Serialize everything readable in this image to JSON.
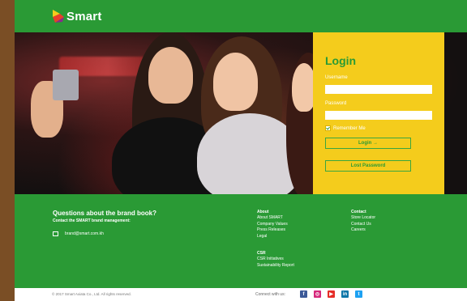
{
  "brand": {
    "name": "Smart",
    "accent": "#2a9a35",
    "panel": "#f4cc1c"
  },
  "login": {
    "title": "Login",
    "username_label": "Username",
    "password_label": "Password",
    "remember_label": "Remember Me",
    "login_button": "Login →",
    "lost_password_button": "Lost Password"
  },
  "footer": {
    "question_title": "Questions about the brand book?",
    "question_sub": "Contact the SMART brand management:",
    "email": "brand@smart.com.kh",
    "about": {
      "title": "About",
      "items": [
        "About SMART",
        "Company Values",
        "Press Releases",
        "Legal"
      ]
    },
    "csr": {
      "title": "CSR",
      "items": [
        "CSR Initiatives",
        "Sustainability Report"
      ]
    },
    "contact": {
      "title": "Contact",
      "items": [
        "Store Locator",
        "Contact Us",
        "Careers"
      ]
    }
  },
  "bottom": {
    "copyright": "© 2017 Smart Axiata Co., Ltd. All rights reserved.",
    "connect_label": "Connect with us:",
    "social": [
      {
        "icon": "facebook-icon",
        "glyph": "f",
        "color": "#3b5998"
      },
      {
        "icon": "instagram-icon",
        "glyph": "◎",
        "color": "#d6287b"
      },
      {
        "icon": "youtube-icon",
        "glyph": "▶",
        "color": "#e52d27"
      },
      {
        "icon": "linkedin-icon",
        "glyph": "in",
        "color": "#0e76a8"
      },
      {
        "icon": "twitter-icon",
        "glyph": "t",
        "color": "#1da1f2"
      }
    ]
  }
}
